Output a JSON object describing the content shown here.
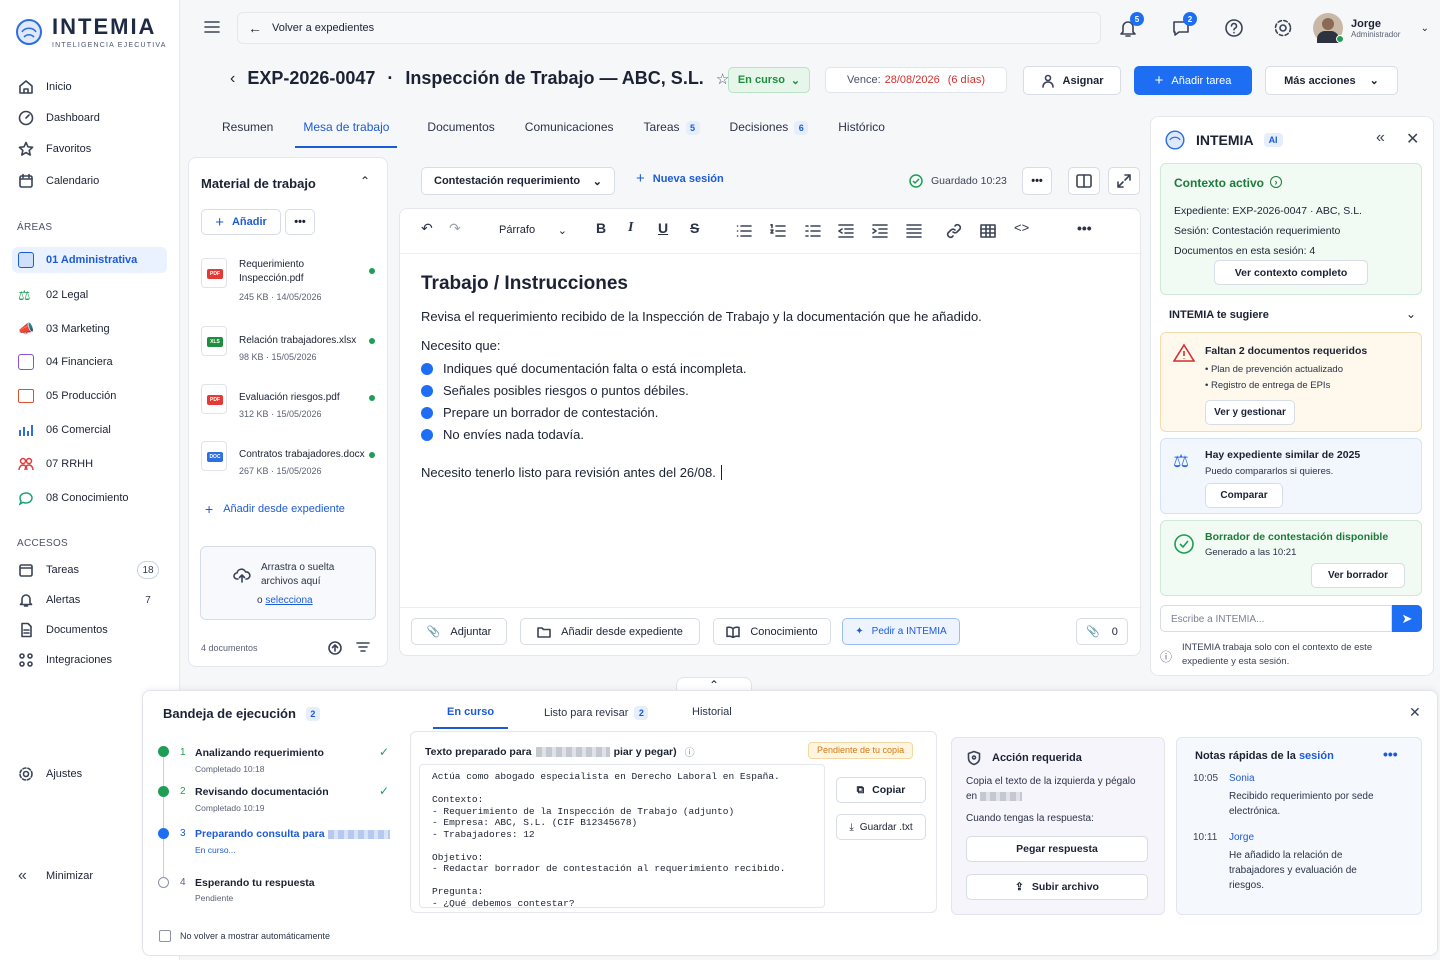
{
  "app": {
    "logo": "INTEMIA",
    "logo_sub": "INTELIGENCIA EJECUTIVA"
  },
  "sidebar": {
    "main": [
      {
        "label": "Inicio",
        "icon": "home-icon"
      },
      {
        "label": "Dashboard",
        "icon": "dashboard-icon"
      },
      {
        "label": "Favoritos",
        "icon": "star-icon"
      },
      {
        "label": "Calendario",
        "icon": "calendar-icon"
      }
    ],
    "areas_title": "ÁREAS",
    "areas": [
      {
        "label": "01 Administrativa",
        "color": "#1d5bd6"
      },
      {
        "label": "02 Legal",
        "color": "#1e9e55"
      },
      {
        "label": "03 Marketing",
        "color": "#f08a1c"
      },
      {
        "label": "04 Financiera",
        "color": "#8a4fd6"
      },
      {
        "label": "05 Producción",
        "color": "#e0502a"
      },
      {
        "label": "06 Comercial",
        "color": "#2d6fe0"
      },
      {
        "label": "07 RRHH",
        "color": "#e03a3a"
      },
      {
        "label": "08 Conocimiento",
        "color": "#19a37a"
      }
    ],
    "access_title": "ACCESOS",
    "access": [
      {
        "label": "Tareas",
        "count": "18"
      },
      {
        "label": "Alertas",
        "count": "7"
      },
      {
        "label": "Documentos",
        "count": ""
      },
      {
        "label": "Integraciones",
        "count": ""
      }
    ],
    "settings": "Ajustes",
    "minimize": "Minimizar"
  },
  "topbar": {
    "back": "Volver a expedientes",
    "notif_count": "5",
    "msg_count": "2",
    "user_name": "Jorge",
    "user_role": "Administrador"
  },
  "header": {
    "code": "EXP-2026-0047",
    "sep": "·",
    "title": "Inspección de Trabajo — ABC, S.L.",
    "status": "En curso",
    "due_label": "Vence:",
    "due_date": "28/08/2026",
    "due_days": "(6 días)",
    "assign": "Asignar",
    "add_task": "Añadir tarea",
    "more": "Más acciones"
  },
  "tabs": [
    {
      "label": "Resumen",
      "count": ""
    },
    {
      "label": "Mesa de trabajo",
      "count": ""
    },
    {
      "label": "Documentos",
      "count": ""
    },
    {
      "label": "Comunicaciones",
      "count": ""
    },
    {
      "label": "Tareas",
      "count": "5"
    },
    {
      "label": "Decisiones",
      "count": "6"
    },
    {
      "label": "Histórico",
      "count": ""
    }
  ],
  "material": {
    "title": "Material de trabajo",
    "add": "Añadir",
    "files": [
      {
        "name": "Requerimiento Inspección.pdf",
        "meta": "245 KB · 14/05/2026",
        "type": "PDF",
        "color": "#e53935"
      },
      {
        "name": "Relación trabajadores.xlsx",
        "meta": "98 KB · 15/05/2026",
        "type": "XLS",
        "color": "#1e8e3e"
      },
      {
        "name": "Evaluación riesgos.pdf",
        "meta": "312 KB · 15/05/2026",
        "type": "PDF",
        "color": "#e53935"
      },
      {
        "name": "Contratos trabajadores.docx",
        "meta": "267 KB · 15/05/2026",
        "type": "DOC",
        "color": "#2d6fe0"
      }
    ],
    "add_from": "Añadir desde expediente",
    "drop": "Arrastra o suelta archivos aquí",
    "drop_or": "o",
    "drop_link": "selecciona",
    "footer": "4 documentos"
  },
  "editor": {
    "session": "Contestación requerimiento",
    "new_session": "Nueva sesión",
    "saved": "Guardado 10:23",
    "style": "Párrafo",
    "heading": "Trabajo / Instrucciones",
    "p1": "Revisa el requerimiento recibido de la Inspección de Trabajo y la documentación que he añadido.",
    "p2": "Necesito que:",
    "items": [
      "Indiques qué documentación falta o está incompleta.",
      "Señales posibles riesgos o puntos débiles.",
      "Prepare un borrador de contestación.",
      "No envíes nada todavía."
    ],
    "p3": "Necesito tenerlo listo para revisión antes del 26/08.",
    "actions": [
      "Adjuntar",
      "Añadir desde expediente",
      "Conocimiento",
      "Pedir a INTEMIA"
    ],
    "attach_count": "0"
  },
  "assistant": {
    "title": "INTEMIA",
    "ai": "AI",
    "ctx_title": "Contexto activo",
    "ctx_lines": [
      "Expediente: EXP-2026-0047 · ABC, S.L.",
      "Sesión: Contestación requerimiento",
      "Documentos en esta sesión: 4"
    ],
    "ctx_btn": "Ver contexto completo",
    "sugg_title": "INTEMIA te sugiere",
    "s1_title": "Faltan 2 documentos requeridos",
    "s1_items": [
      "Plan de prevención actualizado",
      "Registro de entrega de EPIs"
    ],
    "s1_btn": "Ver y gestionar",
    "s2_title": "Hay expediente similar de 2025",
    "s2_sub": "Puedo compararlos si quieres.",
    "s2_btn": "Comparar",
    "s3_title": "Borrador de contestación disponible",
    "s3_sub": "Generado a las 10:21",
    "s3_btn": "Ver borrador",
    "input_ph": "Escribe a INTEMIA...",
    "note": "INTEMIA trabaja solo con el contexto de este expediente y esta sesión."
  },
  "tray": {
    "title": "Bandeja de ejecución",
    "count": "2",
    "tabs": [
      {
        "label": "En curso",
        "count": ""
      },
      {
        "label": "Listo para revisar",
        "count": "2"
      },
      {
        "label": "Historial",
        "count": ""
      }
    ],
    "steps": [
      {
        "n": "1",
        "title": "Analizando requerimiento",
        "sub": "Completado 10:18"
      },
      {
        "n": "2",
        "title": "Revisando documentación",
        "sub": "Completado 10:19"
      },
      {
        "n": "3",
        "title": "Preparando consulta para",
        "sub": "En curso..."
      },
      {
        "n": "4",
        "title": "Esperando tu respuesta",
        "sub": "Pendiente"
      }
    ],
    "no_show": "No volver a mostrar automáticamente",
    "prep_title_a": "Texto preparado para",
    "prep_title_b": "piar y pegar)",
    "prep_badge": "Pendiente de tu copia",
    "prep_text": "Actúa como abogado especialista en Derecho Laboral en España.\n\nContexto:\n- Requerimiento de la Inspección de Trabajo (adjunto)\n- Empresa: ABC, S.L. (CIF B12345678)\n- Trabajadores: 12\n\nObjetivo:\n- Redactar borrador de contestación al requerimiento recibido.\n\nPregunta:\n- ¿Qué debemos contestar?",
    "copy": "Copiar",
    "save_txt": "Guardar .txt",
    "action_title": "Acción requerida",
    "action_text": "Copia el texto de la izquierda y pégalo en",
    "action_when": "Cuando tengas la respuesta:",
    "paste": "Pegar respuesta",
    "upload": "Subir archivo",
    "notes_title_a": "Notas rápidas de la",
    "notes_title_b": "sesión",
    "notes": [
      {
        "time": "10:05",
        "who": "Sonia",
        "text": "Recibido requerimiento por sede electrónica."
      },
      {
        "time": "10:11",
        "who": "Jorge",
        "text": "He añadido la relación de trabajadores y evaluación de riesgos."
      }
    ]
  }
}
